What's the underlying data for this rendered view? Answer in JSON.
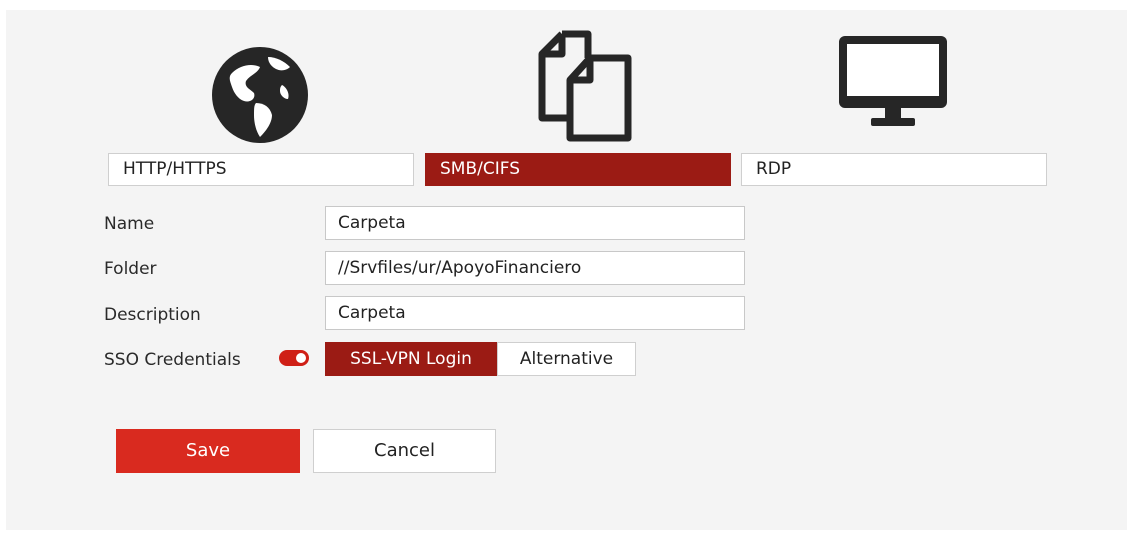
{
  "protocols": {
    "http_label": "HTTP/HTTPS",
    "smb_label": "SMB/CIFS",
    "rdp_label": "RDP",
    "selected": "SMB/CIFS",
    "icons": [
      "globe-icon",
      "files-icon",
      "monitor-icon"
    ]
  },
  "form": {
    "name_label": "Name",
    "name_value": "Carpeta",
    "folder_label": "Folder",
    "folder_value": "//Srvfiles/ur/ApoyoFinanciero",
    "description_label": "Description",
    "description_value": "Carpeta",
    "sso_label": "SSO Credentials",
    "sso_enabled": true,
    "sso_options": [
      "SSL-VPN Login",
      "Alternative"
    ],
    "sso_selected": "SSL-VPN Login"
  },
  "actions": {
    "save_label": "Save",
    "cancel_label": "Cancel"
  },
  "colors": {
    "accent_dark": "#9b1b14",
    "accent": "#d92a1f",
    "icon": "#262626"
  }
}
